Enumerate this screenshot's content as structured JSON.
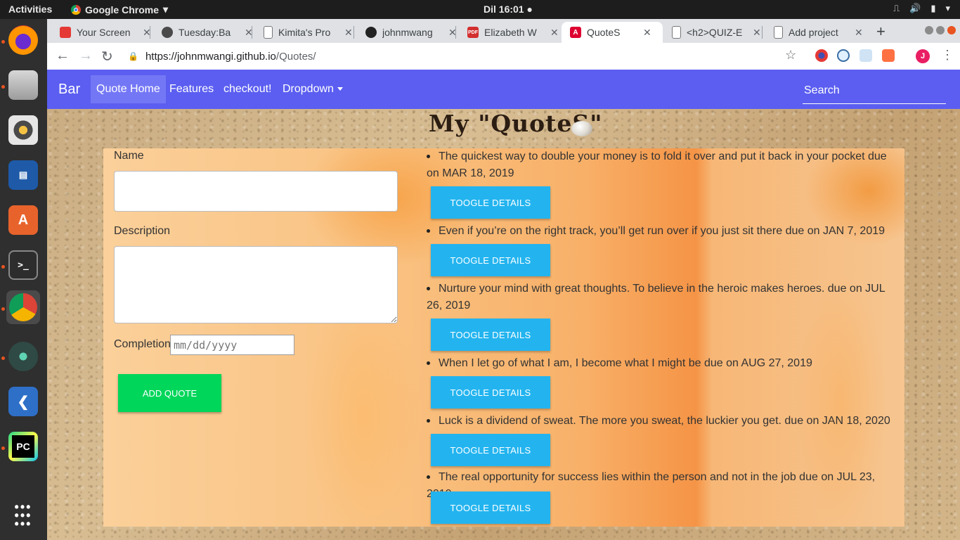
{
  "system": {
    "activities": "Activities",
    "app_menu": "Google Chrome",
    "clock": "Dil 16:01"
  },
  "tabs": [
    {
      "title": "Your Screen",
      "active": false
    },
    {
      "title": "Tuesday:Ba",
      "active": false
    },
    {
      "title": "Kimita's Pro",
      "active": false
    },
    {
      "title": "johnmwang",
      "active": false
    },
    {
      "title": "Elizabeth W",
      "active": false
    },
    {
      "title": "QuoteS",
      "active": true
    },
    {
      "title": "<h2>QUIZ-E",
      "active": false
    },
    {
      "title": "Add project",
      "active": false
    }
  ],
  "address": {
    "scheme_host": "https://johnmwangi.github.io",
    "path": "/Quotes/"
  },
  "profile_initial": "J",
  "navbar": {
    "brand": "Bar",
    "links": [
      "Quote Home",
      "Features",
      "checkout!",
      "Dropdown"
    ],
    "search_placeholder": "Search"
  },
  "heading": "My \"QuoteS\"",
  "form": {
    "name_label": "Name",
    "name_value": "",
    "description_label": "Description",
    "description_value": "",
    "completion_label": "Completion",
    "completion_placeholder": "mm/dd/yyyy",
    "add_button": "ADD QUOTE"
  },
  "quotes": [
    {
      "text": "The quickest way to double your money is to fold it over and put it back in your pocket due on MAR 18, 2019",
      "button": "TOOGLE DETAILS"
    },
    {
      "text": "Even if you’re on the right track, you’ll get run over if you just sit there due on JAN 7, 2019",
      "button": "TOOGLE DETAILS"
    },
    {
      "text": "Nurture your mind with great thoughts. To believe in the heroic makes heroes. due on JUL 26, 2019",
      "button": "TOOGLE DETAILS"
    },
    {
      "text": "When I let go of what I am, I become what I might be due on AUG 27, 2019",
      "button": "TOOGLE DETAILS"
    },
    {
      "text": "Luck is a dividend of sweat. The more you sweat, the luckier you get. due on JAN 18, 2020",
      "button": "TOOGLE DETAILS"
    },
    {
      "text": "The real opportunity for success lies within the person and not in the job due on JUL 23, 2019",
      "button": "TOOGLE DETAILS"
    }
  ],
  "colors": {
    "navbar": "#5b5ef0",
    "add_button": "#00d65a",
    "toggle_button": "#23b4ef"
  }
}
